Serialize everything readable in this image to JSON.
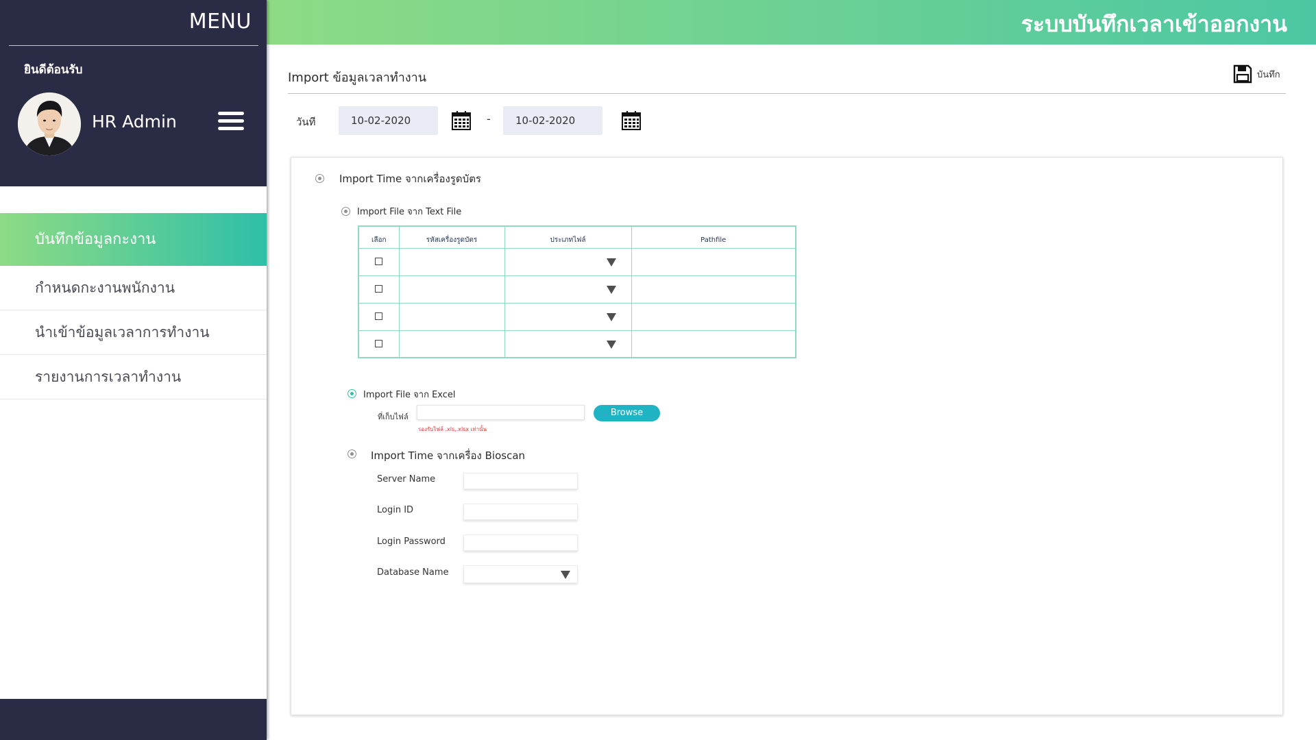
{
  "app": {
    "header_title": "ระบบบันทึกเวลาเข้าออกงาน"
  },
  "sidebar": {
    "menu_title": "MENU",
    "welcome": "ยินดีต้อนรับ",
    "user_name": "HR Admin",
    "items": [
      {
        "label": "บันทึกข้อมูลกะงาน",
        "active": true
      },
      {
        "label": "กำหนดกะงานพนักงาน",
        "active": false
      },
      {
        "label": "นำเข้าข้อมูลเวลาการทำงาน",
        "active": false
      },
      {
        "label": "รายงานการเวลาทำงาน",
        "active": false
      }
    ]
  },
  "page": {
    "title": "Import ข้อมูลเวลาทำงาน",
    "save_label": "บันทึก",
    "date_label": "วันที",
    "date_from": "10-02-2020",
    "date_separator": "-",
    "date_to": "10-02-2020"
  },
  "import_card": {
    "label": "Import Time จากเครื่องรูดบัตร",
    "text_file": {
      "label": "Import File จาก Text File",
      "columns": [
        "เลือก",
        "รหัสเครื่องรูดบัตร",
        "ประเภทไฟล์",
        "Pathfile"
      ],
      "row_count": 4
    },
    "excel": {
      "label": "Import File จาก Excel",
      "file_label": "ที่เก็บไฟล์",
      "hint": "รองรับไฟล์ .xls,.xlsx เท่านั้น",
      "browse_label": "Browse",
      "selected": true
    }
  },
  "bioscan": {
    "label": "Import Time จากเครื่อง Bioscan",
    "server_name_label": "Server Name",
    "login_id_label": "Login ID",
    "login_password_label": "Login Password",
    "database_name_label": "Database Name"
  },
  "colors": {
    "sidebar_bg": "#2a2b45",
    "accent_green": "#8ddb84",
    "accent_teal": "#2fbfa8",
    "browse_button": "#1fb3c4",
    "hint_red": "#e03030"
  },
  "icons": [
    "hamburger-icon",
    "save-icon",
    "calendar-icon",
    "dropdown-arrow-icon",
    "radio-icon",
    "checkbox-icon"
  ]
}
